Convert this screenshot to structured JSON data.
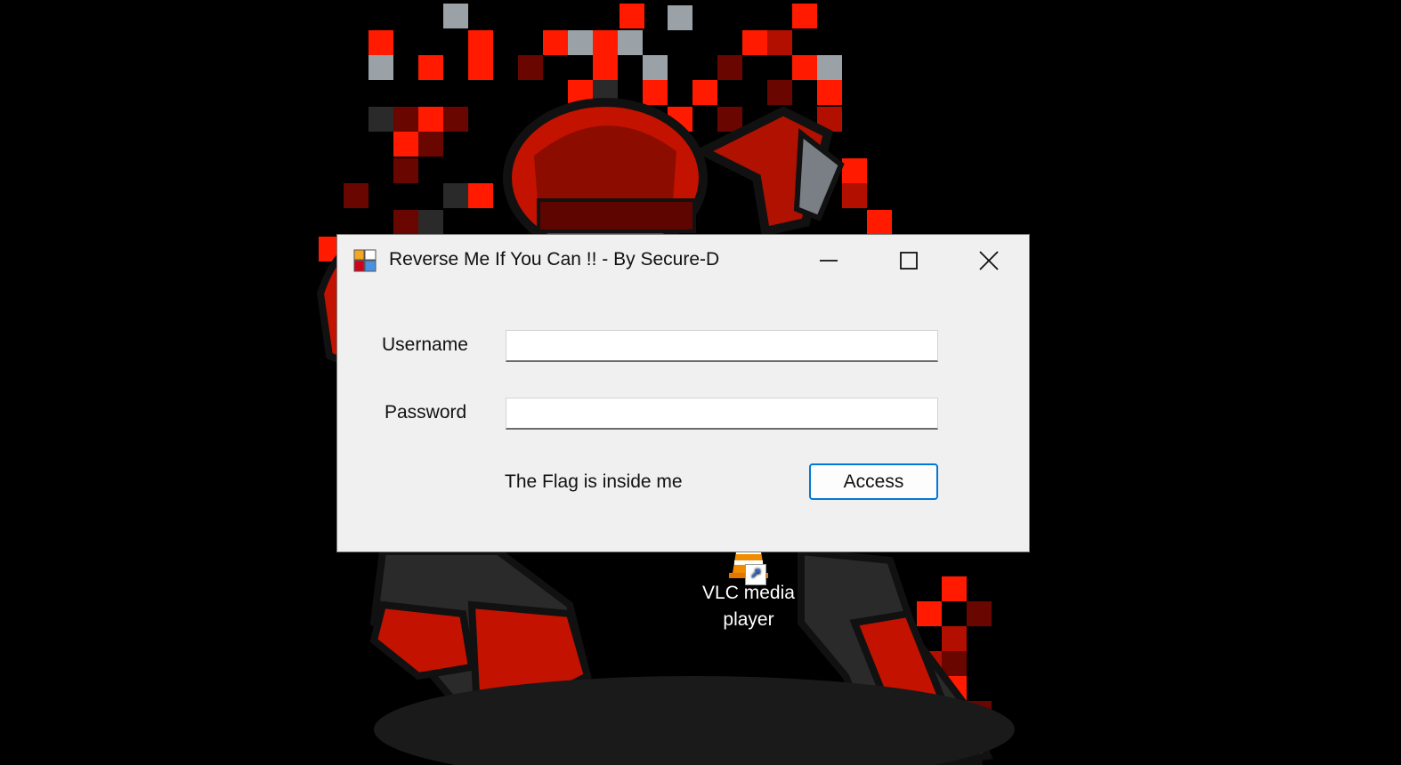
{
  "desktop": {
    "icons": [
      {
        "label_line1": "VLC media",
        "label_line2": "player",
        "icon": "vlc-cone-icon"
      }
    ]
  },
  "window": {
    "title": "Reverse Me If You Can !! - By Secure-D",
    "app_icon": "winforms-app-icon",
    "controls": {
      "minimize": "minimize-icon",
      "maximize": "maximize-icon",
      "close": "close-icon"
    },
    "form": {
      "username_label": "Username",
      "username_value": "",
      "password_label": "Password",
      "password_value": "",
      "hint_text": "The Flag is inside me",
      "access_button_label": "Access"
    }
  },
  "colors": {
    "accent": "#0078d7",
    "wallpaper_red": "#ff1a00",
    "window_bg": "#f0f0f0"
  }
}
